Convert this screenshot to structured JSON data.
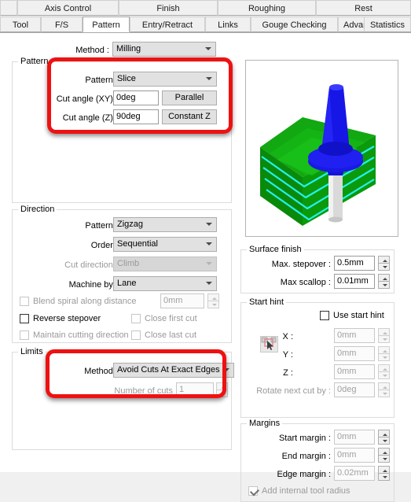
{
  "tabs_row1": [
    {
      "label": "",
      "selected": false,
      "spacer": true
    },
    {
      "label": "Axis Control",
      "selected": false
    },
    {
      "label": "Finish",
      "selected": false
    },
    {
      "label": "Roughing",
      "selected": false
    },
    {
      "label": "Rest",
      "selected": false
    }
  ],
  "tabs_row2": [
    {
      "label": "Tool",
      "selected": false
    },
    {
      "label": "F/S",
      "selected": false
    },
    {
      "label": "Pattern",
      "selected": true
    },
    {
      "label": "Entry/Retract",
      "selected": false
    },
    {
      "label": "Links",
      "selected": false
    },
    {
      "label": "Gouge Checking",
      "selected": false
    },
    {
      "label": "Advanced",
      "selected": false
    },
    {
      "label": "Statistics",
      "selected": false
    }
  ],
  "top": {
    "method_label": "Method :",
    "method_value": "Milling"
  },
  "pattern": {
    "caption": "Pattern",
    "pattern_label": "Pattern :",
    "pattern_value": "Slice",
    "cut_angle_xy_label": "Cut angle (XY) :",
    "cut_angle_xy_value": "0deg",
    "parallel_button": "Parallel",
    "cut_angle_z_label": "Cut angle (Z) :",
    "cut_angle_z_value": "90deg",
    "constant_z_button": "Constant Z"
  },
  "direction": {
    "caption": "Direction",
    "pattern_label": "Pattern :",
    "pattern_value": "Zigzag",
    "order_label": "Order :",
    "order_value": "Sequential",
    "cut_direction_label": "Cut direction :",
    "cut_direction_value": "Climb",
    "machine_by_label": "Machine by :",
    "machine_by_value": "Lane",
    "blend_spiral_label": "Blend spiral along distance",
    "blend_spiral_value": "0mm",
    "reverse_stepover_label": "Reverse stepover",
    "close_first_cut_label": "Close first cut",
    "maintain_cutting_direction_label": "Maintain cutting direction",
    "close_last_cut_label": "Close last cut"
  },
  "limits": {
    "caption": "Limits",
    "method_label": "Method :",
    "method_value": "Avoid Cuts At Exact Edges",
    "number_of_cuts_label": "Number of cuts",
    "number_of_cuts_value": "1"
  },
  "surface_finish": {
    "caption": "Surface finish",
    "max_stepover_label": "Max. stepover :",
    "max_stepover_value": "0.5mm",
    "max_scallop_label": "Max scallop :",
    "max_scallop_value": "0.01mm"
  },
  "start_hint": {
    "caption": "Start hint",
    "use_start_hint_label": "Use start hint",
    "x_label": "X :",
    "x_value": "0mm",
    "y_label": "Y :",
    "y_value": "0mm",
    "z_label": "Z :",
    "z_value": "0mm",
    "rotate_next_cut_label": "Rotate next cut by :",
    "rotate_next_cut_value": "0deg"
  },
  "margins": {
    "caption": "Margins",
    "start_margin_label": "Start margin :",
    "start_margin_value": "0mm",
    "end_margin_label": "End margin :",
    "end_margin_value": "0mm",
    "edge_margin_label": "Edge margin :",
    "edge_margin_value": "0.02mm",
    "add_internal_tool_radius_label": "Add internal tool radius"
  },
  "colors": {
    "highlight": "#ee1111",
    "stock_green": "#10a010",
    "toolpath_cyan": "#24f0f0",
    "tool_blue": "#1414e0",
    "shank_grey": "#d8d8d8"
  }
}
